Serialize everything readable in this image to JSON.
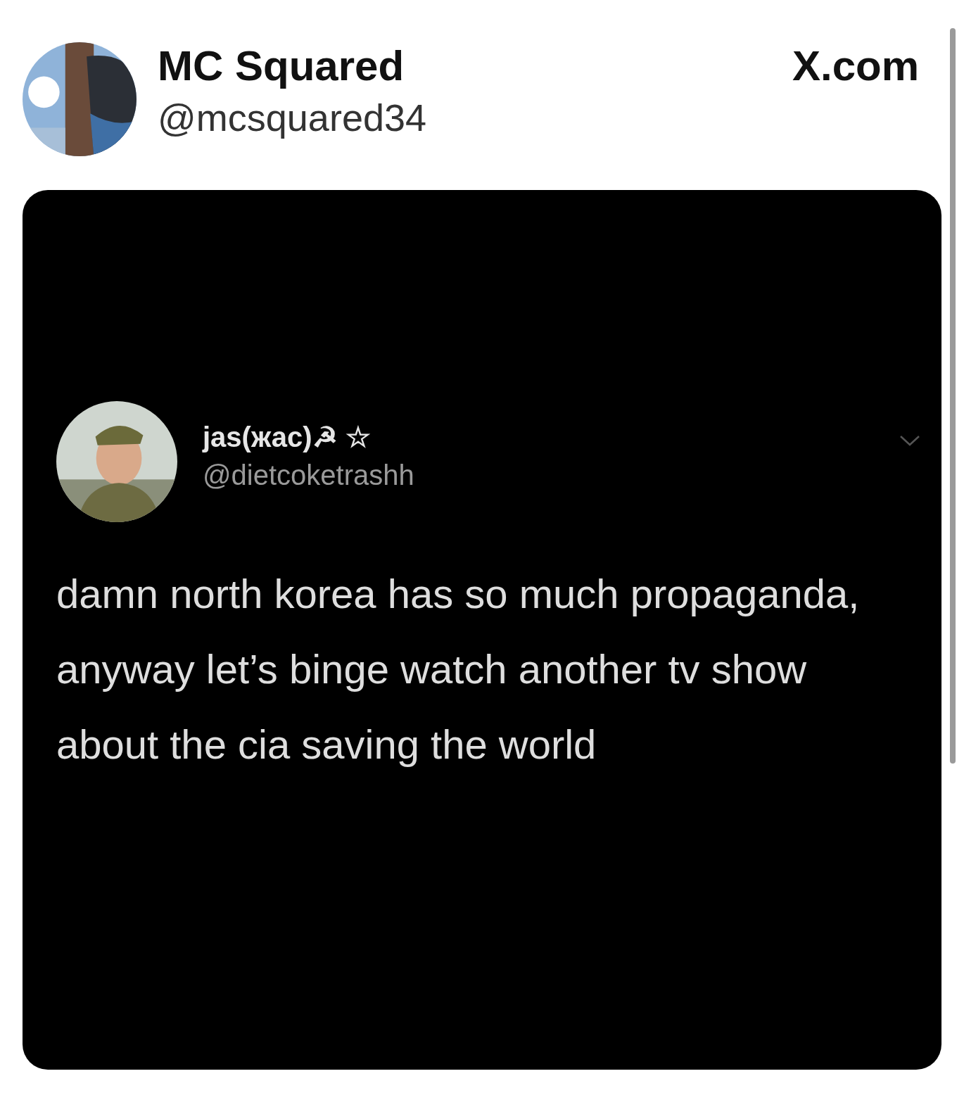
{
  "post": {
    "author_name": "MC Squared",
    "handle": "@mcsquared34",
    "source": "X.com"
  },
  "embedded_tweet": {
    "author_name": "jas(жас)☭ ☆",
    "handle": "@dietcoketrashh",
    "text": "damn north korea has so much propaganda, anyway let’s binge watch another tv show about the cia saving the world"
  }
}
